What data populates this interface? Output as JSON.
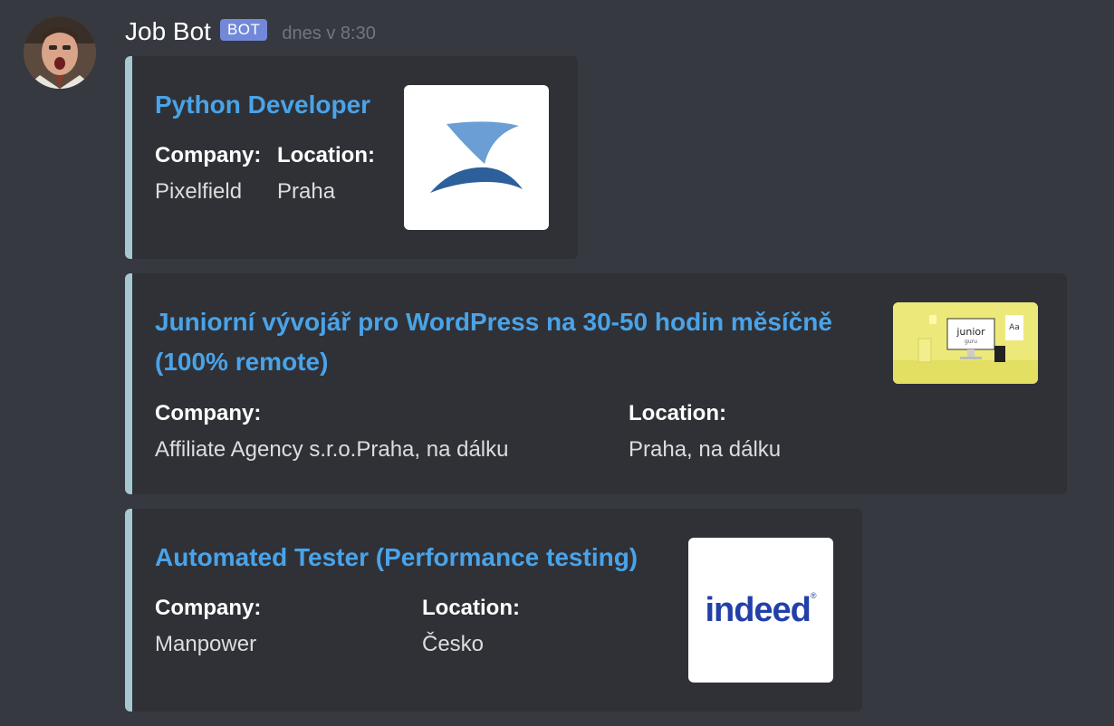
{
  "author": {
    "name": "Job Bot",
    "tag": "BOT",
    "timestamp": "dnes v 8:30",
    "avatar_icon": "avatar-photo"
  },
  "colors": {
    "background": "#36393f",
    "embed_background": "#2f3136",
    "embed_border": "#a6c8cf",
    "link": "#4aa3e8",
    "bot_tag": "#7289da"
  },
  "embeds": [
    {
      "title": "Python Developer",
      "fields": [
        {
          "name": "Company:",
          "value": "Pixelfield"
        },
        {
          "name": "Location:",
          "value": "Praha"
        }
      ],
      "thumbnail": "pixelfield-shark-fin-logo"
    },
    {
      "title_line1": "Juniorní vývojář pro WordPress na 30-50 hodin měsíčně",
      "title_line2": "(100% remote)",
      "fields": [
        {
          "name": "Company:",
          "value": "Affiliate Agency s.r.o.Praha, na dálku"
        },
        {
          "name": "Location:",
          "value": "Praha, na dálku"
        }
      ],
      "thumbnail": "junior-guru-desk-image",
      "thumbnail_text": "junior",
      "thumbnail_subtext": "guru",
      "thumbnail_card": "Aa"
    },
    {
      "title": "Automated Tester (Performance testing)",
      "fields": [
        {
          "name": "Company:",
          "value": "Manpower"
        },
        {
          "name": "Location:",
          "value": "Česko"
        }
      ],
      "thumbnail": "indeed-logo",
      "thumbnail_text": "indeed",
      "thumbnail_mark": "®"
    }
  ]
}
